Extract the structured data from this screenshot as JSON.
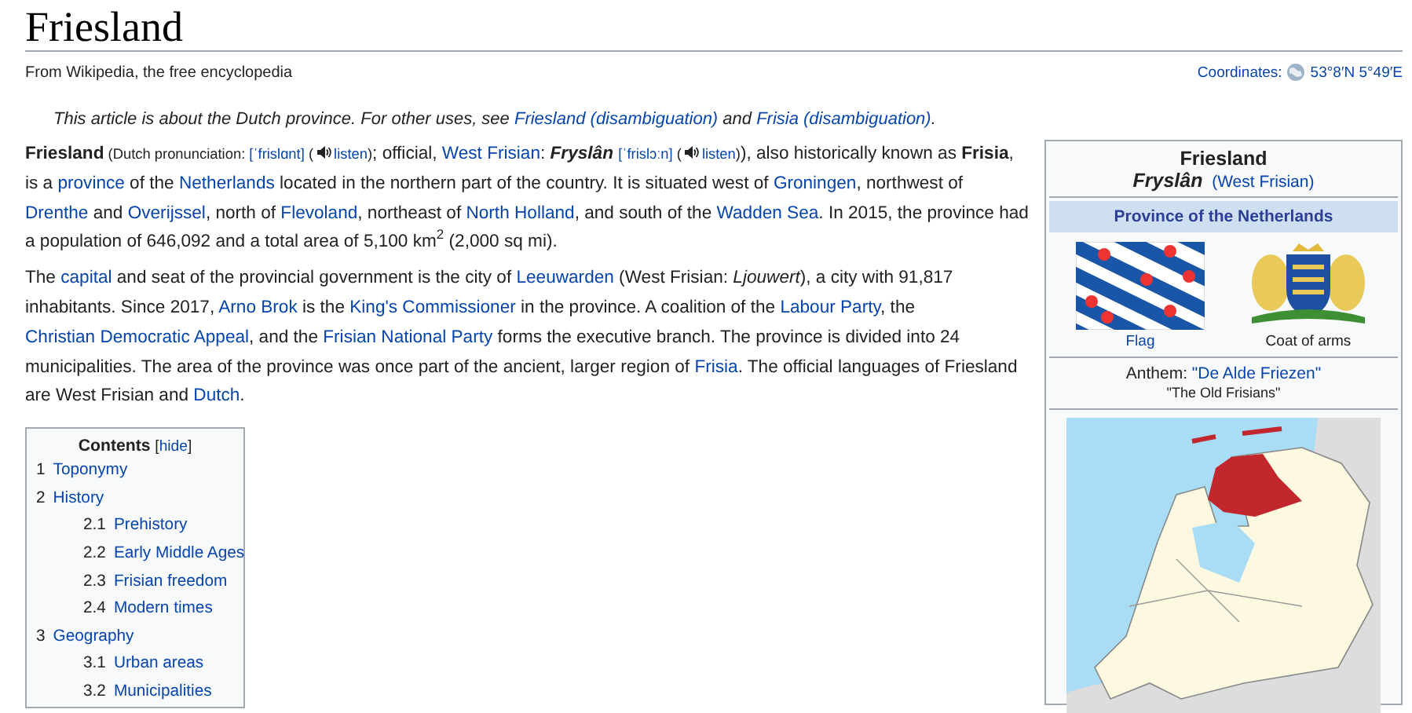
{
  "title": "Friesland",
  "tagline": "From Wikipedia, the free encyclopedia",
  "coordinates": {
    "label": "Coordinates:",
    "value": "53°8′N 5°49′E"
  },
  "hatnote": [
    {
      "kind": "t",
      "text": "This article is about the Dutch province. For other uses, see "
    },
    {
      "kind": "a",
      "text": "Friesland (disambiguation)"
    },
    {
      "kind": "t",
      "text": " and "
    },
    {
      "kind": "a",
      "text": "Frisia (disambiguation)"
    },
    {
      "kind": "t",
      "text": "."
    }
  ],
  "paragraphs": [
    [
      {
        "kind": "b",
        "text": "Friesland"
      },
      {
        "kind": "s",
        "text": " (Dutch pronunciation: "
      },
      {
        "kind": "sa",
        "text": "[ˈfrislɑnt]"
      },
      {
        "kind": "s",
        "text": " ("
      },
      {
        "kind": "audio",
        "text": "listen"
      },
      {
        "kind": "s",
        "text": ")"
      },
      {
        "kind": "t",
        "text": "; official, "
      },
      {
        "kind": "a",
        "text": "West Frisian"
      },
      {
        "kind": "t",
        "text": ": "
      },
      {
        "kind": "bi",
        "text": "Fryslân",
        "gap": true
      },
      {
        "kind": "sa",
        "text": "[ˈfrislɔːn]"
      },
      {
        "kind": "s",
        "text": " ("
      },
      {
        "kind": "audio",
        "text": "listen"
      },
      {
        "kind": "s",
        "text": ")"
      },
      {
        "kind": "t",
        "text": "), also historically known as "
      },
      {
        "kind": "b",
        "text": "Frisia"
      },
      {
        "kind": "t",
        "text": ", is a "
      },
      {
        "kind": "a",
        "text": "province"
      },
      {
        "kind": "t",
        "text": " of the "
      },
      {
        "kind": "a",
        "text": "Netherlands"
      },
      {
        "kind": "t",
        "text": " located in the northern part of the country. It is situated west of "
      },
      {
        "kind": "a",
        "text": "Groningen"
      },
      {
        "kind": "t",
        "text": ", northwest of "
      },
      {
        "kind": "a",
        "text": "Drenthe"
      },
      {
        "kind": "t",
        "text": " and "
      },
      {
        "kind": "a",
        "text": "Overijssel"
      },
      {
        "kind": "t",
        "text": ", north of "
      },
      {
        "kind": "a",
        "text": "Flevoland"
      },
      {
        "kind": "t",
        "text": ", northeast of "
      },
      {
        "kind": "a",
        "text": "North Holland"
      },
      {
        "kind": "t",
        "text": ", and south of the "
      },
      {
        "kind": "a",
        "text": "Wadden Sea"
      },
      {
        "kind": "t",
        "text": ". In 2015, the province had a population of 646,092 and a total area of 5,100 km"
      },
      {
        "kind": "sup",
        "text": "2"
      },
      {
        "kind": "t",
        "text": " (2,000 sq mi)."
      }
    ],
    [
      {
        "kind": "t",
        "text": "The "
      },
      {
        "kind": "a",
        "text": "capital"
      },
      {
        "kind": "t",
        "text": " and seat of the provincial government is the city of "
      },
      {
        "kind": "a",
        "text": "Leeuwarden"
      },
      {
        "kind": "t",
        "text": " (West Frisian: "
      },
      {
        "kind": "i",
        "text": "Ljouwert"
      },
      {
        "kind": "t",
        "text": "), a city with 91,817 inhabitants. Since 2017, "
      },
      {
        "kind": "a",
        "text": "Arno Brok"
      },
      {
        "kind": "t",
        "text": " is the "
      },
      {
        "kind": "a",
        "text": "King's Commissioner"
      },
      {
        "kind": "t",
        "text": " in the province. A coalition of the "
      },
      {
        "kind": "a",
        "text": "Labour Party"
      },
      {
        "kind": "t",
        "text": ", the "
      },
      {
        "kind": "a",
        "text": "Christian Democratic Appeal"
      },
      {
        "kind": "t",
        "text": ", and the "
      },
      {
        "kind": "a",
        "text": "Frisian National Party"
      },
      {
        "kind": "t",
        "text": " forms the executive branch. The province is divided into 24 municipalities. The area of the province was once part of the ancient, larger region of "
      },
      {
        "kind": "a",
        "text": "Frisia"
      },
      {
        "kind": "t",
        "text": ". The official languages of Friesland are West Frisian and "
      },
      {
        "kind": "a",
        "text": "Dutch"
      },
      {
        "kind": "t",
        "text": "."
      }
    ]
  ],
  "toc": {
    "title": "Contents",
    "toggle": "[hide]",
    "items": [
      {
        "number": "1",
        "label": "Toponymy"
      },
      {
        "number": "2",
        "label": "History",
        "children": [
          {
            "number": "2.1",
            "label": "Prehistory"
          },
          {
            "number": "2.2",
            "label": "Early Middle Ages"
          },
          {
            "number": "2.3",
            "label": "Frisian freedom"
          },
          {
            "number": "2.4",
            "label": "Modern times"
          }
        ]
      },
      {
        "number": "3",
        "label": "Geography",
        "children": [
          {
            "number": "3.1",
            "label": "Urban areas"
          },
          {
            "number": "3.2",
            "label": "Municipalities"
          }
        ]
      }
    ]
  },
  "infobox": {
    "name": "Friesland",
    "native_name": "Fryslân",
    "language": "(West Frisian)",
    "subtitle": "Province of the Netherlands",
    "flag_caption": "Flag",
    "arms_caption": "Coat of arms",
    "anthem_label": "Anthem: ",
    "anthem": "\"De Alde Friezen\"",
    "anthem_translation": "\"The Old Frisians\""
  }
}
